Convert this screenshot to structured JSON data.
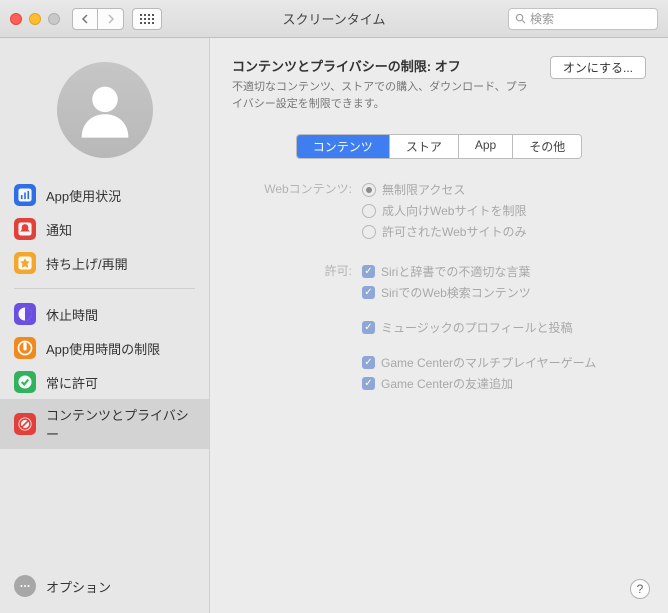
{
  "window": {
    "title": "スクリーンタイム",
    "search_placeholder": "検索"
  },
  "sidebar": {
    "items": [
      {
        "label": "App使用状況",
        "color": "#2f6fe6"
      },
      {
        "label": "通知",
        "color": "#e2403a"
      },
      {
        "label": "持ち上げ/再開",
        "color": "#f3a72c"
      }
    ],
    "items2": [
      {
        "label": "休止時間",
        "color": "#6a4fe0"
      },
      {
        "label": "App使用時間の制限",
        "color": "#f08a1f"
      },
      {
        "label": "常に許可",
        "color": "#33b25d"
      },
      {
        "label": "コンテンツとプライバシー",
        "color": "#e2403a"
      }
    ],
    "options_label": "オプション"
  },
  "main": {
    "heading_prefix": "コンテンツとプライバシーの制限: ",
    "heading_state": "オフ",
    "description": "不適切なコンテンツ、ストアでの購入、ダウンロード、プライバシー設定を制限できます。",
    "turn_on_label": "オンにする...",
    "tabs": [
      "コンテンツ",
      "ストア",
      "App",
      "その他"
    ],
    "web_label": "Webコンテンツ:",
    "web_opts": [
      "無制限アクセス",
      "成人向けWebサイトを制限",
      "許可されたWebサイトのみ"
    ],
    "allow_label": "許可:",
    "allow_opts": [
      "Siriと辞書での不適切な言葉",
      "SiriでのWeb検索コンテンツ",
      "",
      "ミュージックのプロフィールと投稿",
      "",
      "Game Centerのマルチプレイヤーゲーム",
      "Game Centerの友達追加"
    ]
  }
}
